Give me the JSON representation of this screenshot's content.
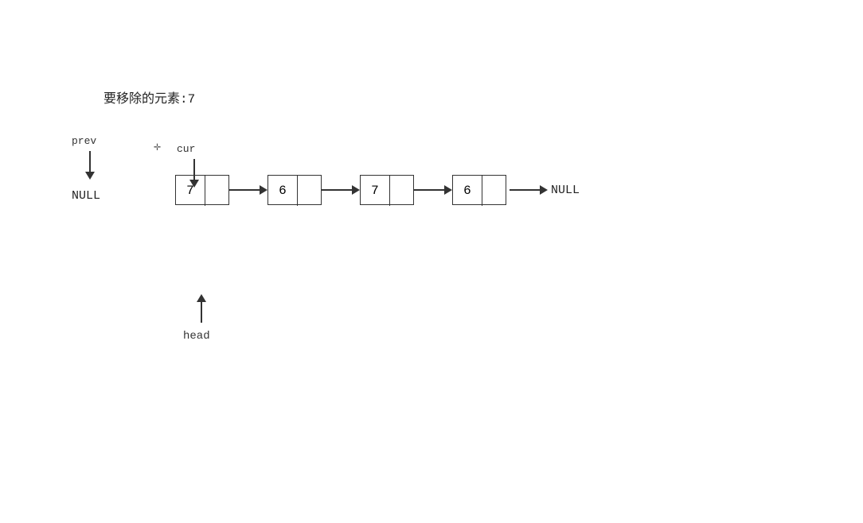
{
  "title": {
    "label": "要移除的元素:7"
  },
  "labels": {
    "prev": "prev",
    "cur": "cur",
    "head": "head",
    "null_left": "NULL",
    "null_right": "NULL"
  },
  "nodes": [
    {
      "val": "7",
      "id": "node1"
    },
    {
      "val": "6",
      "id": "node2"
    },
    {
      "val": "7",
      "id": "node3"
    },
    {
      "val": "6",
      "id": "node4"
    }
  ]
}
